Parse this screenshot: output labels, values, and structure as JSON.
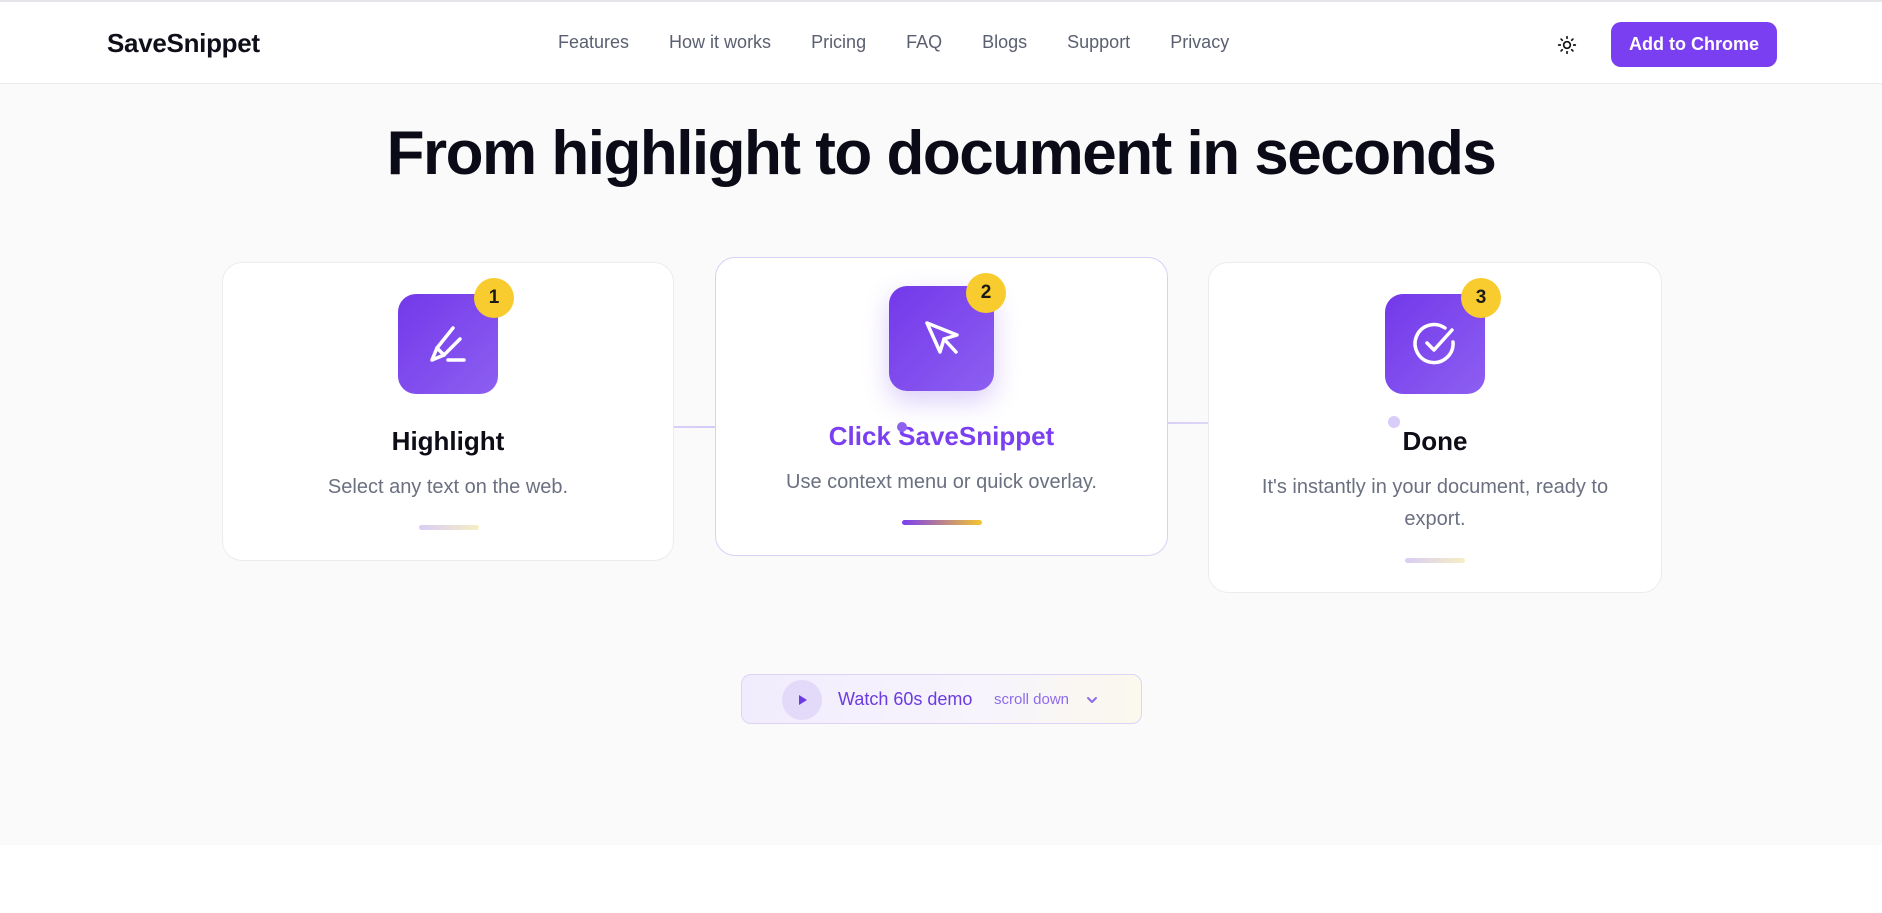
{
  "header": {
    "logo": "SaveSnippet",
    "nav": [
      "Features",
      "How it works",
      "Pricing",
      "FAQ",
      "Blogs",
      "Support",
      "Privacy"
    ],
    "theme_icon": "sun-icon",
    "cta_label": "Add to Chrome"
  },
  "main": {
    "title": "From highlight to document in seconds",
    "steps": [
      {
        "number": "1",
        "icon": "highlighter-icon",
        "title": "Highlight",
        "description": "Select any text on the web."
      },
      {
        "number": "2",
        "icon": "cursor-arrow-icon",
        "title": "Click SaveSnippet",
        "description": "Use context menu or quick overlay."
      },
      {
        "number": "3",
        "icon": "check-circle-icon",
        "title": "Done",
        "description": "It's instantly in your document, ready to export."
      }
    ],
    "demo": {
      "label": "Watch 60s demo",
      "hint": "scroll down",
      "play_icon": "play-icon",
      "chevron_icon": "chevron-down-icon"
    }
  },
  "colors": {
    "brand_purple": "#7a3ff0",
    "badge_yellow": "#f8cc2e",
    "text_dark": "#0b0b18",
    "text_muted": "#6b7080"
  }
}
